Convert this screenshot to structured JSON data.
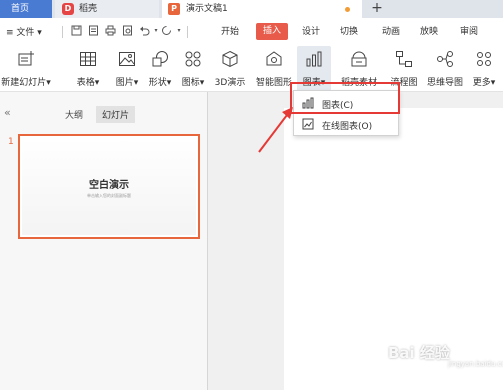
{
  "tabs": {
    "home": "首页",
    "docer": "稻壳",
    "docer_logo": "D",
    "document": "演示文稿1",
    "document_logo": "P",
    "new_tab": "+"
  },
  "menu": {
    "file": "≡ 文件 ▾",
    "ribbon_tabs": [
      "开始",
      "插入",
      "设计",
      "切换",
      "动画",
      "放映",
      "审阅"
    ]
  },
  "ribbon": {
    "items": [
      {
        "label": "新建幻灯片▾",
        "icon": "new-slide-icon"
      },
      {
        "label": "表格▾",
        "icon": "table-icon"
      },
      {
        "label": "图片▾",
        "icon": "picture-icon"
      },
      {
        "label": "形状▾",
        "icon": "shape-icon"
      },
      {
        "label": "图标▾",
        "icon": "icon-icon"
      },
      {
        "label": "3D演示",
        "icon": "3d-icon"
      },
      {
        "label": "智能图形",
        "icon": "smartart-icon"
      },
      {
        "label": "图表▾",
        "icon": "chart-icon"
      },
      {
        "label": "稻壳素材",
        "icon": "material-icon"
      },
      {
        "label": "流程图",
        "icon": "flowchart-icon"
      },
      {
        "label": "思维导图",
        "icon": "mindmap-icon"
      },
      {
        "label": "更多▾",
        "icon": "more-icon"
      }
    ]
  },
  "left_panel": {
    "collapse": "«",
    "tab_outline": "大纲",
    "tab_slides": "幻灯片",
    "slide_number": "1",
    "slide_title": "空白演示",
    "slide_subtitle": "单击输入您的封面副标题"
  },
  "dropdown": {
    "items": [
      {
        "label": "图表(C)",
        "icon": "bar-chart-icon"
      },
      {
        "label": "在线图表(O)",
        "icon": "online-chart-icon"
      }
    ]
  },
  "watermark": {
    "main": "Bai 经验",
    "sub": "jingyan.baidu.com"
  },
  "colors": {
    "accent": "#e85b4a",
    "home_tab": "#4a7bd3",
    "slide_border": "#e8663c",
    "highlight": "#e53935"
  }
}
